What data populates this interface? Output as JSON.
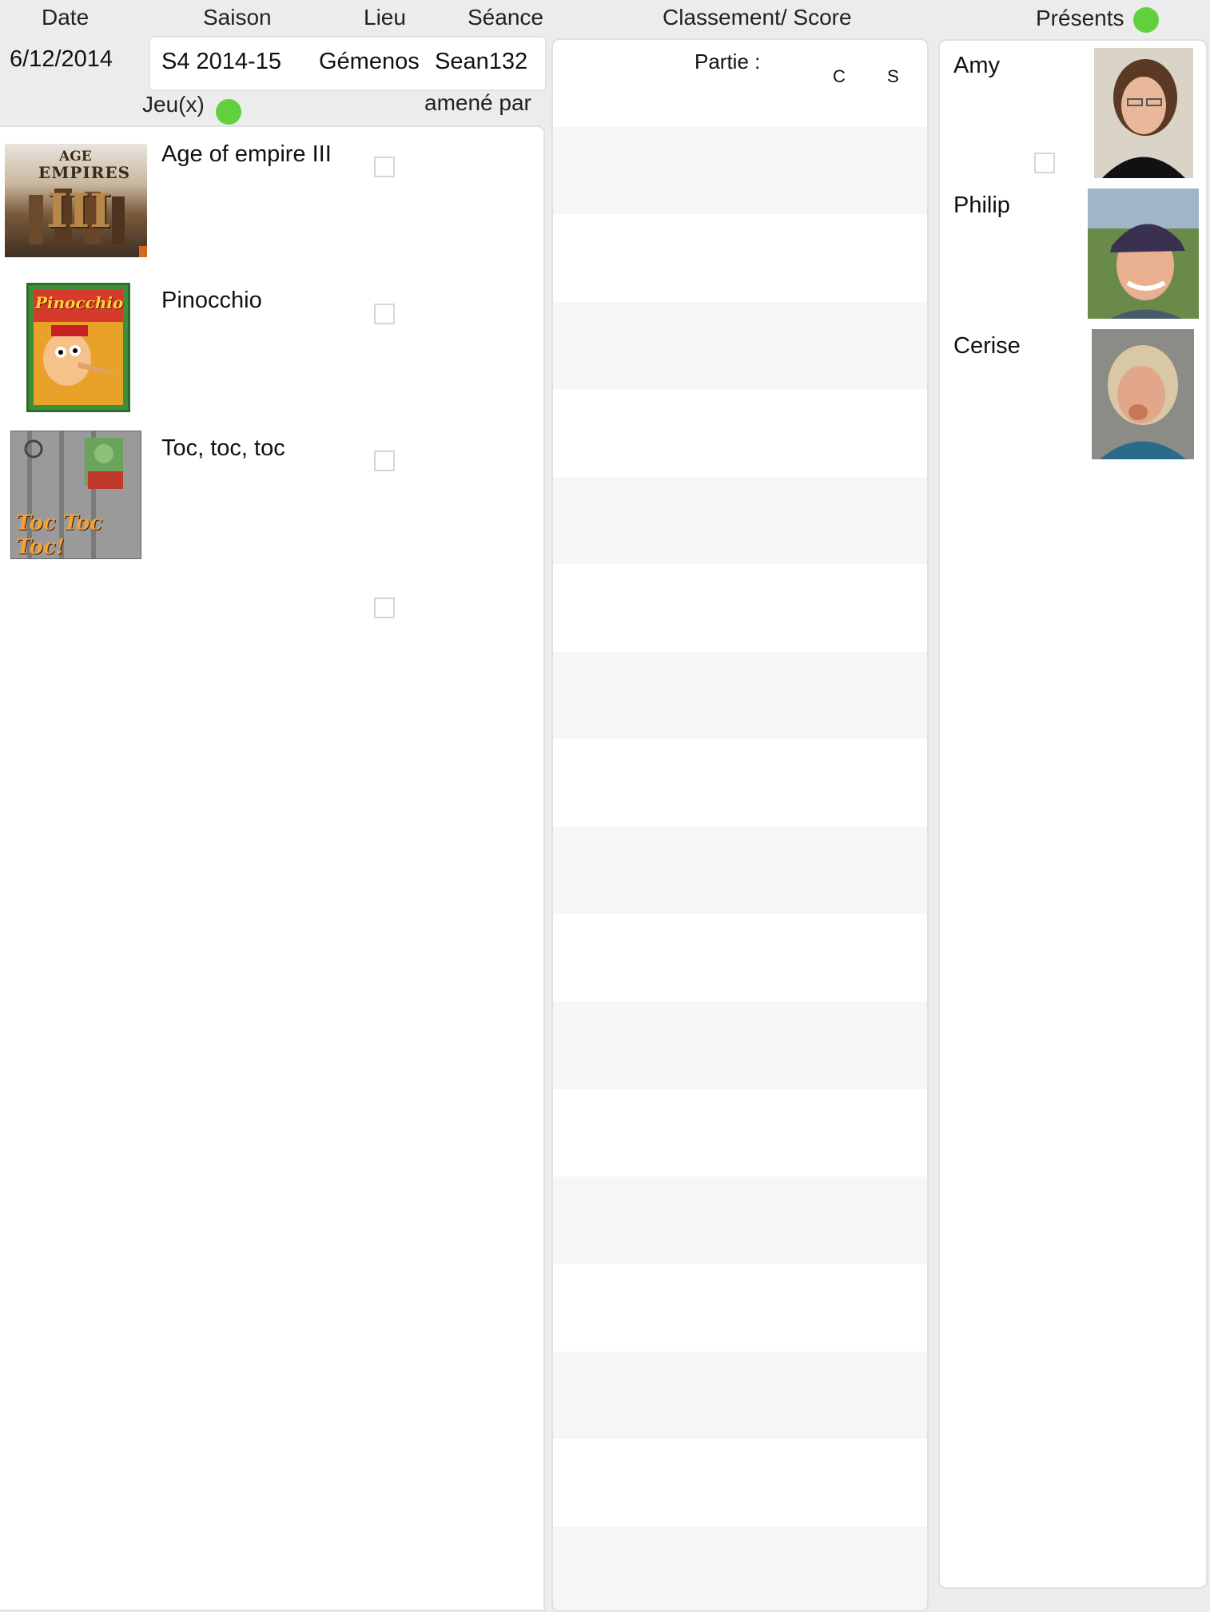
{
  "header": {
    "date_label": "Date",
    "saison_label": "Saison",
    "lieu_label": "Lieu",
    "seance_label": "Séance",
    "classement_label": "Classement/ Score",
    "presents_label": "Présents",
    "jeux_label": "Jeu(x)",
    "amene_par_label": "amené par"
  },
  "session": {
    "date": "6/12/2014",
    "saison": "S4 2014-15",
    "lieu": "Gémenos",
    "seance": "Sean132"
  },
  "score_panel": {
    "partie_label": "Partie :",
    "col_c": "C",
    "col_s": "S"
  },
  "games": [
    {
      "title": "Age of empire III",
      "cover_icon": "age-of-empires-cover",
      "cover_text_1": "AGE",
      "cover_text_2": "EMPIRES",
      "cover_text_3": "III"
    },
    {
      "title": "Pinocchio",
      "cover_icon": "pinocchio-cover",
      "cover_text_1": "Pinocchio"
    },
    {
      "title": "Toc, toc, toc",
      "cover_icon": "toc-toc-toc-cover",
      "cover_text_1": "Toc Toc Toc!"
    }
  ],
  "players": [
    {
      "name": "Amy",
      "photo_icon": "amy-photo"
    },
    {
      "name": "Philip",
      "photo_icon": "philip-photo"
    },
    {
      "name": "Cerise",
      "photo_icon": "cerise-photo"
    }
  ],
  "colors": {
    "status_green": "#62d03c",
    "page_bg": "#ececec",
    "stripe": "#f6f6f6"
  }
}
